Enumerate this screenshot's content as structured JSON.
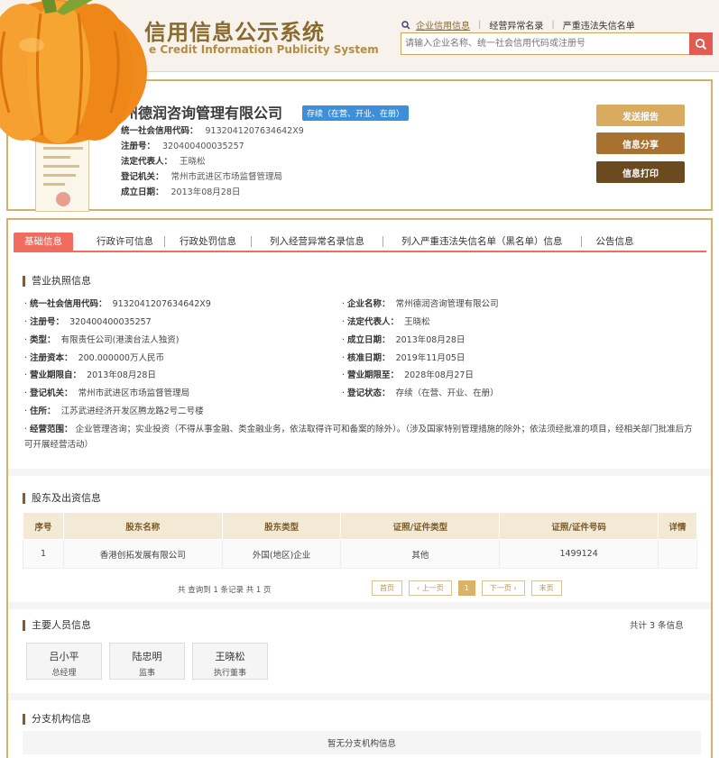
{
  "header": {
    "title": "信用信息公示系统",
    "subtitle": "e Credit Information Publicity System",
    "nav": [
      "企业信用信息",
      "经营异常名录",
      "严重违法失信名单"
    ],
    "search_placeholder": "请输入企业名称、统一社会信用代码或注册号"
  },
  "company": {
    "name": "常州德润咨询管理有限公司",
    "status": "存续（在营、开业、在册）",
    "fields": [
      {
        "k": "统一社会信用代码：",
        "v": "9132041207634642X9"
      },
      {
        "k": "注册号：",
        "v": "320400400035257"
      },
      {
        "k": "法定代表人：",
        "v": "王晓松"
      },
      {
        "k": "登记机关：",
        "v": "常州市武进区市场监督管理局"
      },
      {
        "k": "成立日期：",
        "v": "2013年08月28日"
      }
    ],
    "buttons": [
      "发送报告",
      "信息分享",
      "信息打印"
    ]
  },
  "tabs": [
    "基础信息",
    "行政许可信息",
    "行政处罚信息",
    "列入经营异常名录信息",
    "列入严重违法失信名单（黑名单）信息",
    "公告信息"
  ],
  "license": {
    "title": "营业执照信息",
    "left": [
      {
        "k": "统一社会信用代码：",
        "v": "9132041207634642X9"
      },
      {
        "k": "注册号：",
        "v": "320400400035257"
      },
      {
        "k": "类型：",
        "v": "有限责任公司(港澳台法人独资)"
      },
      {
        "k": "注册资本：",
        "v": "200.000000万人民币"
      },
      {
        "k": "营业期限自：",
        "v": "2013年08月28日"
      },
      {
        "k": "登记机关：",
        "v": "常州市武进区市场监督管理局"
      },
      {
        "k": "住所：",
        "v": "江苏武进经济开发区腾龙路2号二号楼"
      }
    ],
    "right": [
      {
        "k": "企业名称：",
        "v": "常州德润咨询管理有限公司"
      },
      {
        "k": "法定代表人：",
        "v": "王晓松"
      },
      {
        "k": "成立日期：",
        "v": "2013年08月28日"
      },
      {
        "k": "核准日期：",
        "v": "2019年11月05日"
      },
      {
        "k": "营业期限至：",
        "v": "2028年08月27日"
      },
      {
        "k": "登记状态：",
        "v": "存续（在营、开业、在册）"
      }
    ],
    "scope_label": "经营范围：",
    "scope": "企业管理咨询；实业投资（不得从事金融、类金融业务，依法取得许可和备案的除外）。（涉及国家特别管理措施的除外；依法须经批准的项目，经相关部门批准后方可开展经营活动）"
  },
  "shareholders": {
    "title": "股东及出资信息",
    "columns": [
      "序号",
      "股东名称",
      "股东类型",
      "证照/证件类型",
      "证照/证件号码",
      "详情"
    ],
    "rows": [
      [
        "1",
        "香港创拓发展有限公司",
        "外国(地区)企业",
        "其他",
        "1499124",
        ""
      ]
    ],
    "pager_info": "共 查询到 1 条记录 共 1 页",
    "pager": [
      "首页",
      "‹ 上一页",
      "1",
      "下一页 ›",
      "末页"
    ]
  },
  "staff": {
    "title": "主要人员信息",
    "total": "共计 3 条信息",
    "people": [
      {
        "name": "吕小平",
        "role": "总经理"
      },
      {
        "name": "陆忠明",
        "role": "监事"
      },
      {
        "name": "王晓松",
        "role": "执行董事"
      }
    ]
  },
  "branches": {
    "title": "分支机构信息",
    "empty": "暂无分支机构信息"
  },
  "colors": {
    "accent": "#ef6c5f",
    "gold": "#d3b16a",
    "badge": "#3c8fd8"
  }
}
